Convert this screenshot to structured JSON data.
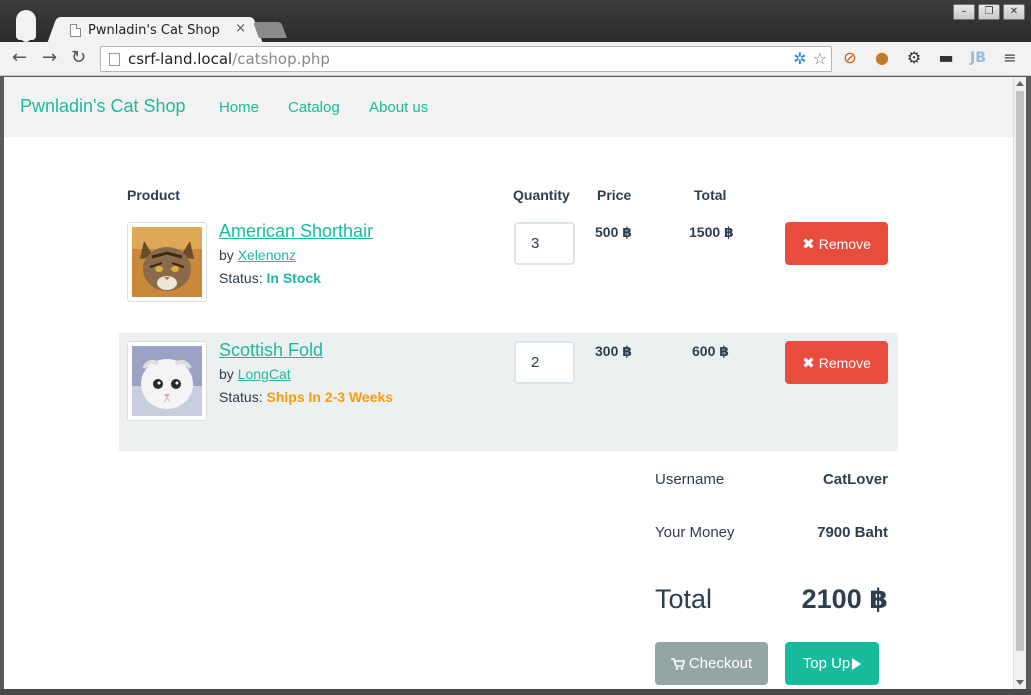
{
  "browser": {
    "tab_title": "Pwnladin's Cat Shop",
    "url_host": "csrf-land.local",
    "url_path": "/catshop.php",
    "window_buttons": [
      "–",
      "❐",
      "✕"
    ]
  },
  "site": {
    "brand": "Pwnladin's Cat Shop",
    "nav": [
      "Home",
      "Catalog",
      "About us"
    ]
  },
  "cart": {
    "headers": {
      "product": "Product",
      "quantity": "Quantity",
      "price": "Price",
      "total": "Total"
    },
    "items": [
      {
        "name": "American Shorthair",
        "by_label": "by",
        "seller": "Xelenonz",
        "status_label": "Status:",
        "status": "In Stock",
        "quantity": "3",
        "price": "500 ฿",
        "total": "1500 ฿",
        "remove_label": "Remove"
      },
      {
        "name": "Scottish Fold",
        "by_label": "by",
        "seller": "LongCat",
        "status_label": "Status:",
        "status": "Ships In 2-3 Weeks",
        "quantity": "2",
        "price": "300 ฿",
        "total": "600 ฿",
        "remove_label": "Remove"
      }
    ]
  },
  "summary": {
    "username_label": "Username",
    "username": "CatLover",
    "money_label": "Your Money",
    "money": "7900 Baht",
    "total_label": "Total",
    "total": "2100 ฿",
    "checkout_label": "Checkout",
    "topup_label": "Top Up"
  },
  "colors": {
    "accent": "#18bc9c",
    "danger": "#e74c3c",
    "warning": "#f39c12",
    "text": "#2c3e50",
    "muted_button": "#95a5a6"
  },
  "icons": [
    "page-icon",
    "back-icon",
    "forward-icon",
    "reload-icon",
    "network-icon",
    "star-icon",
    "block-icon",
    "cookie-icon",
    "gear-icon",
    "mask-icon",
    "jb-icon",
    "menu-icon",
    "remove-x-icon",
    "cart-icon",
    "play-icon"
  ]
}
